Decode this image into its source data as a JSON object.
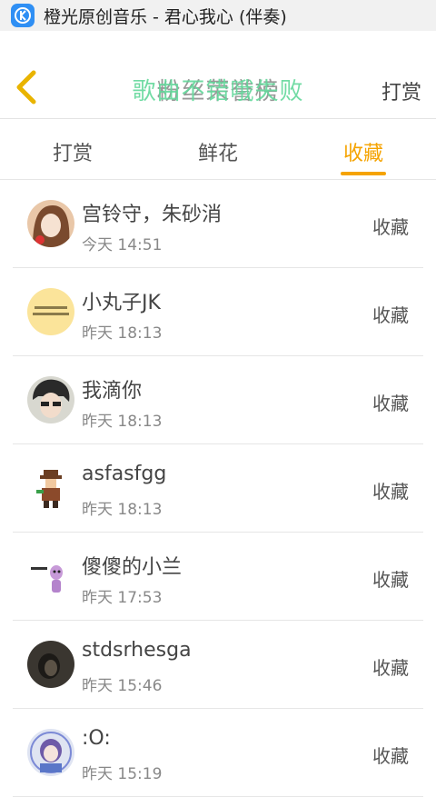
{
  "titlebar": {
    "title": "橙光原创音乐 - 君心我心 (伴奏)",
    "app_icon": "k-logo-icon"
  },
  "header": {
    "title_old": "粉丝荣誉榜",
    "title_new": "歌曲不错哦",
    "title_overlay": "失败",
    "reward_label": "打赏"
  },
  "tabs": [
    {
      "label": "打赏"
    },
    {
      "label": "鲜花"
    },
    {
      "label": "收藏",
      "active": true
    }
  ],
  "colors": {
    "accent": "#f5a300",
    "overlay_green": "#63d89b"
  },
  "list": [
    {
      "name": "宫铃守，朱砂消",
      "time": "今天 14:51",
      "action": "收藏",
      "avatar": "girl-portrait-avatar"
    },
    {
      "name": "小丸子JK",
      "time": "昨天 18:13",
      "action": "收藏",
      "avatar": "yellow-text-avatar"
    },
    {
      "name": "我滴你",
      "time": "昨天 18:13",
      "action": "收藏",
      "avatar": "boy-portrait-avatar"
    },
    {
      "name": "asfasfgg",
      "time": "昨天 18:13",
      "action": "收藏",
      "avatar": "pixel-character-avatar"
    },
    {
      "name": "傻傻的小兰",
      "time": "昨天 17:53",
      "action": "收藏",
      "avatar": "cartoon-avatar"
    },
    {
      "name": "stdsrhesga",
      "time": "昨天 15:46",
      "action": "收藏",
      "avatar": "dark-photo-avatar"
    },
    {
      "name": ":O:",
      "time": "昨天 15:19",
      "action": "收藏",
      "avatar": "anime-girl-avatar"
    }
  ]
}
